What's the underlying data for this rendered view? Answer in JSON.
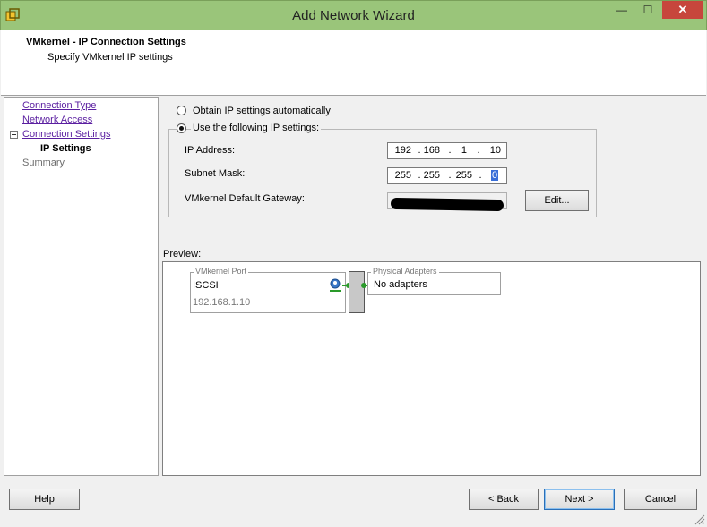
{
  "window": {
    "title": "Add Network Wizard",
    "minimize_glyph": "—",
    "maximize_glyph": "☐",
    "close_glyph": "✕",
    "icon": "vsphere-app-icon"
  },
  "header": {
    "title": "VMkernel - IP Connection Settings",
    "subtitle": "Specify VMkernel IP settings"
  },
  "nav": {
    "items": [
      {
        "label": "Connection Type"
      },
      {
        "label": "Network Access"
      },
      {
        "label": "Connection Settings"
      },
      {
        "label": "IP Settings"
      },
      {
        "label": "Summary"
      }
    ]
  },
  "ip_settings": {
    "obtain_auto_label": "Obtain IP settings automatically",
    "use_following_label": "Use the following IP settings:",
    "selected": "use_following",
    "ip_address_label": "IP Address:",
    "ip_address": [
      "192",
      "168",
      "1",
      "10"
    ],
    "subnet_mask_label": "Subnet Mask:",
    "subnet_mask": [
      "255",
      "255",
      "255",
      "0"
    ],
    "gateway_label": "VMkernel Default Gateway:",
    "edit_button": "Edit..."
  },
  "preview": {
    "label": "Preview:",
    "vmkernel_port_legend": "VMkernel Port",
    "port_name": "ISCSI",
    "port_ip": "192.168.1.10",
    "physical_adapters_legend": "Physical Adapters",
    "adapters_text": "No adapters"
  },
  "footer": {
    "help": "Help",
    "back": "< Back",
    "next": "Next >",
    "cancel": "Cancel"
  },
  "colors": {
    "titlebar": "#9ac57a",
    "close": "#c7463c",
    "link": "#5a1ea0",
    "connector": "#2a9a2a"
  }
}
